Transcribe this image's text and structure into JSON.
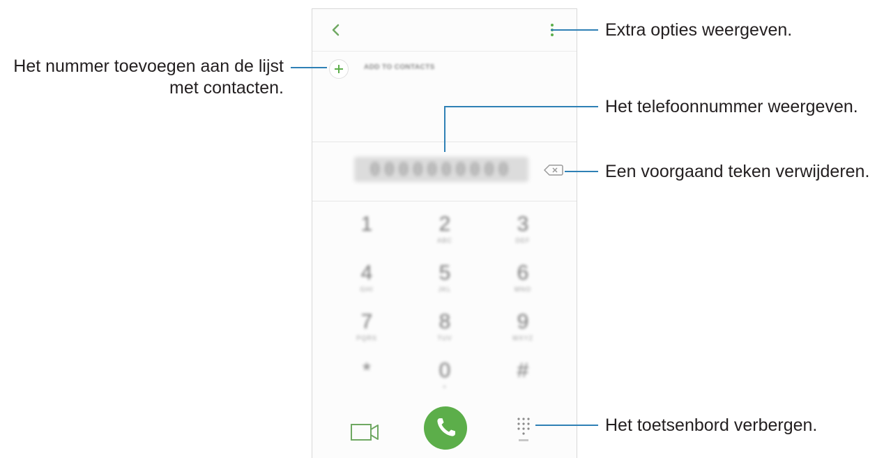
{
  "phone": {
    "add_to_contacts_label": "ADD TO CONTACTS",
    "phone_number": "0000000000",
    "keypad": [
      {
        "digit": "1",
        "letters": ""
      },
      {
        "digit": "2",
        "letters": "ABC"
      },
      {
        "digit": "3",
        "letters": "DEF"
      },
      {
        "digit": "4",
        "letters": "GHI"
      },
      {
        "digit": "5",
        "letters": "JKL"
      },
      {
        "digit": "6",
        "letters": "MNO"
      },
      {
        "digit": "7",
        "letters": "PQRS"
      },
      {
        "digit": "8",
        "letters": "TUV"
      },
      {
        "digit": "9",
        "letters": "WXYZ"
      },
      {
        "digit": "*",
        "letters": ""
      },
      {
        "digit": "0",
        "letters": "+"
      },
      {
        "digit": "#",
        "letters": ""
      }
    ],
    "accent_color": "#5cae4a",
    "icons": {
      "back": "chevron-left-icon",
      "more": "more-options-icon",
      "add": "plus-icon",
      "backspace": "backspace-icon",
      "video": "video-call-icon",
      "call": "phone-icon",
      "keypad": "keypad-icon"
    }
  },
  "callouts": {
    "more_options": "Extra opties weergeven.",
    "add_contact_line1": "Het nummer toevoegen aan de lijst",
    "add_contact_line2": "met contacten.",
    "show_number": "Het telefoonnummer weergeven.",
    "delete_char": "Een voorgaand teken verwijderen.",
    "hide_keypad": "Het toetsenbord verbergen."
  },
  "colors": {
    "leader_line": "#2e80b5"
  }
}
